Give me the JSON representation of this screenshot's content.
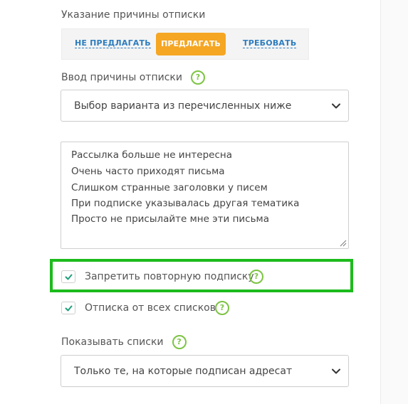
{
  "unsubscribe_reason": {
    "label": "Указание причины отписки",
    "options": [
      "НЕ ПРЕДЛАГАТЬ",
      "ПРЕДЛАГАТЬ",
      "ТРЕБОВАТЬ"
    ],
    "selected": "ПРЕДЛАГАТЬ"
  },
  "reason_input": {
    "label": "Ввод причины отписки",
    "help": "?",
    "select_value": "Выбор варианта из перечисленных ниже"
  },
  "reasons_textarea": {
    "lines": [
      "Рассылка больше не интересна",
      "Очень часто приходят письма",
      "Слишком странные заголовки у писем",
      "При подписке указывалась другая тематика",
      "Просто не присылайте мне эти письма"
    ]
  },
  "checkboxes": {
    "forbid_resubscribe": {
      "label": "Запретить повторную подписку",
      "checked": true,
      "help": "?"
    },
    "unsubscribe_all": {
      "label": "Отписка от всех списков",
      "checked": true,
      "help": "?"
    }
  },
  "show_lists": {
    "label": "Показывать списки",
    "help": "?",
    "select_value": "Только те, на которые подписан адресат"
  },
  "colors": {
    "accent_orange": "#f5a623",
    "link_blue": "#2d7dbf",
    "help_green": "#7cc443",
    "highlight_green": "#1cbb1c"
  },
  "icons": {
    "help": "question-circle-icon",
    "select_arrow": "chevron-down-icon",
    "check": "checkmark-icon",
    "resize": "resize-grip-icon"
  }
}
